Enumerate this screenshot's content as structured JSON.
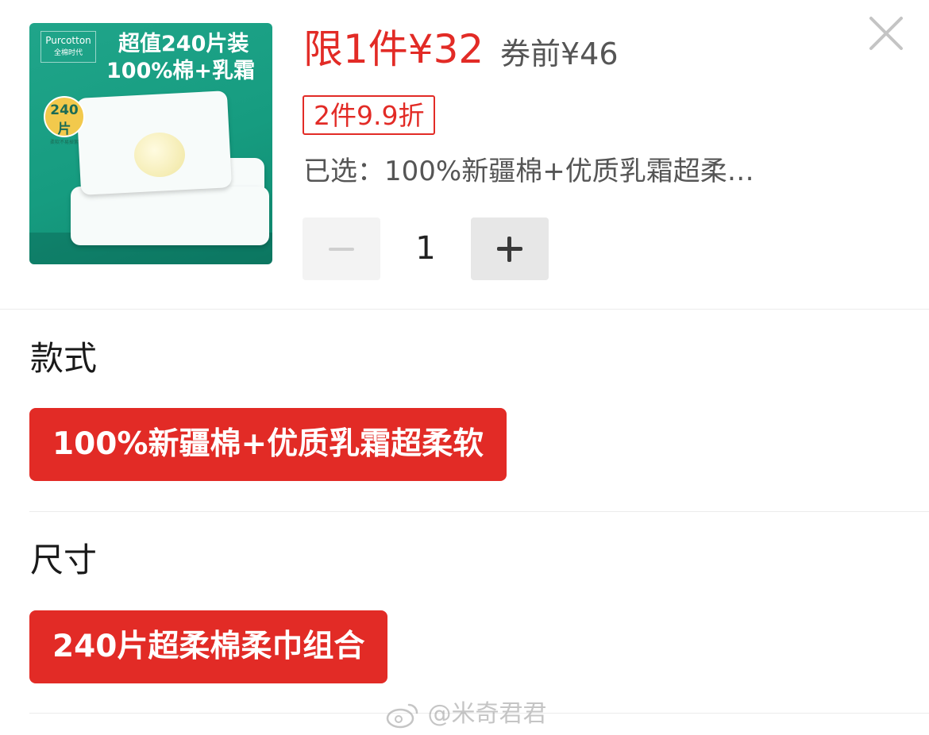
{
  "product": {
    "image": {
      "brand": "Purcotton",
      "brand_sub": "全棉时代",
      "headline_1": "超值240片装",
      "headline_2": "100%棉+乳霜",
      "badge_count": "240片",
      "badge_text": "柔软不易掉絮"
    },
    "price_label": "限1件¥32",
    "price_before_coupon": "券前¥46",
    "discount_tag": "2件9.9折",
    "selected_summary": "已选：100%新疆棉+优质乳霜超柔…"
  },
  "quantity": {
    "value": "1",
    "minus_icon": "minus-icon",
    "plus_icon": "plus-icon"
  },
  "close_icon": "close-icon",
  "sections": {
    "style": {
      "title": "款式",
      "options": [
        "100%新疆棉+优质乳霜超柔软"
      ]
    },
    "size": {
      "title": "尺寸",
      "options": [
        "240片超柔棉柔巾组合"
      ]
    }
  },
  "watermark": {
    "text": "@米奇君君",
    "icon": "weibo-icon"
  },
  "colors": {
    "accent": "#e22b26",
    "image_bg": "#1a9f84"
  }
}
